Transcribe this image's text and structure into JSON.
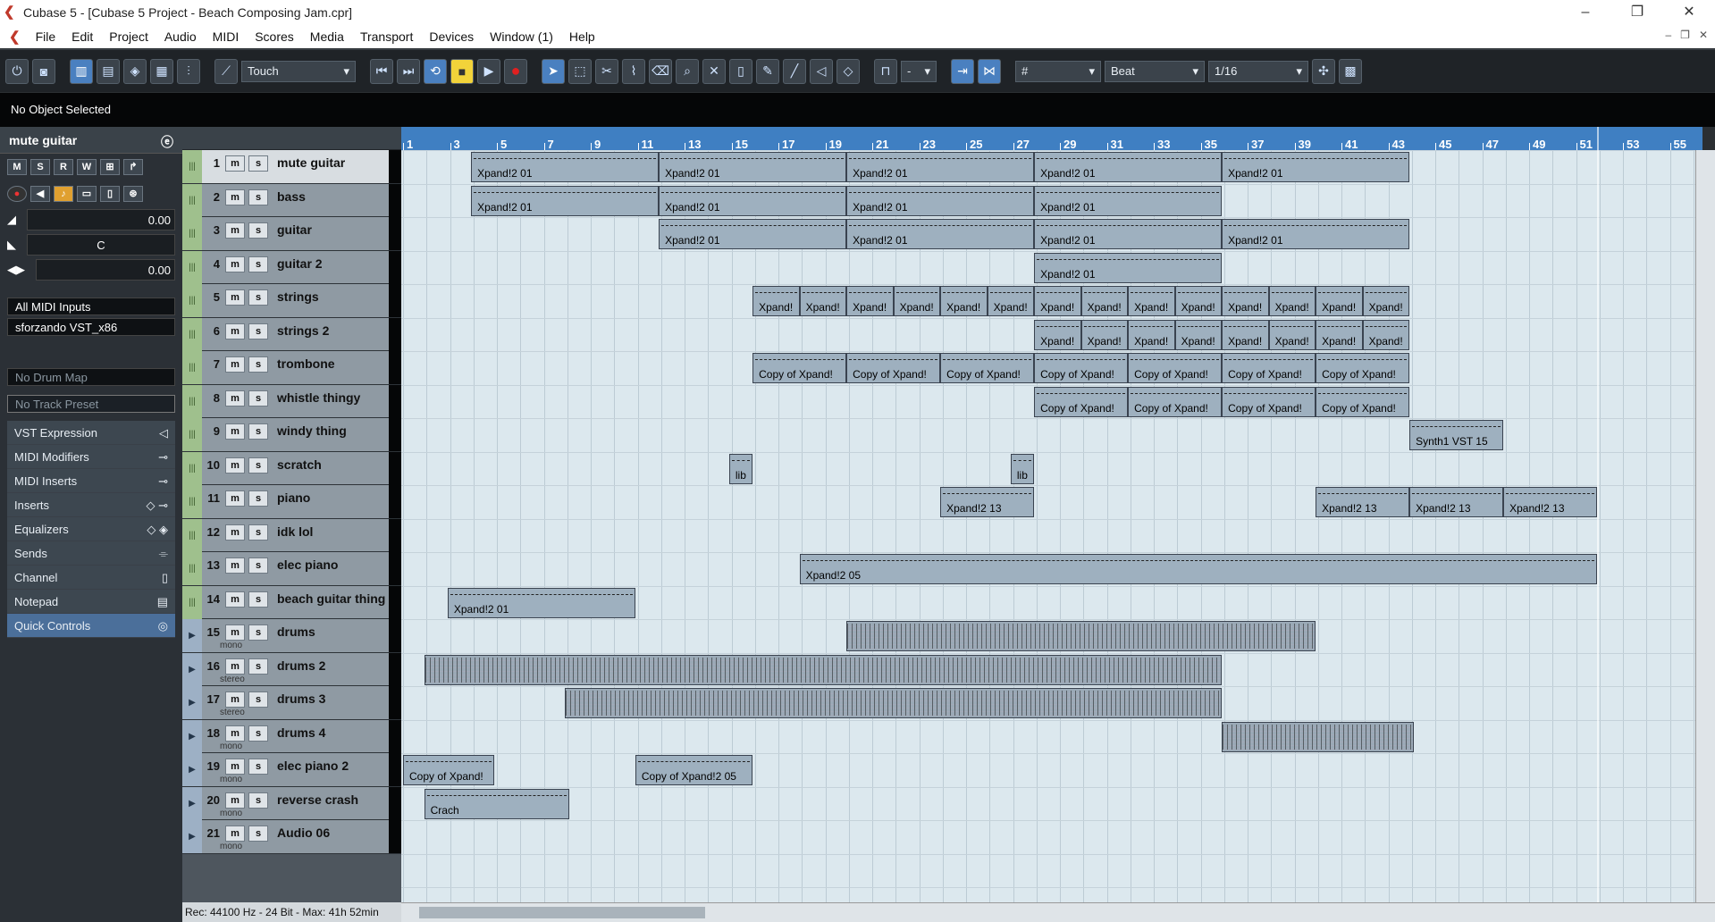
{
  "window": {
    "title": "Cubase 5 - [Cubase 5 Project - Beach Composing Jam.cpr]",
    "controls": [
      "–",
      "❐",
      "✕"
    ]
  },
  "menu": [
    "File",
    "Edit",
    "Project",
    "Audio",
    "MIDI",
    "Scores",
    "Media",
    "Transport",
    "Devices",
    "Window (1)",
    "Help"
  ],
  "toolbar": {
    "automation_mode": "Touch",
    "snap_type": "Beat",
    "quantize": "1/16",
    "nudge": "-"
  },
  "info_line": "No Object Selected",
  "inspector": {
    "track_name": "mute guitar",
    "volume": "0.00",
    "pan": "C",
    "delay": "0.00",
    "input": "All MIDI Inputs",
    "output": "sforzando VST_x86",
    "drum_map": "No Drum Map",
    "track_preset": "No Track Preset",
    "sections": [
      "VST Expression",
      "MIDI Modifiers",
      "MIDI Inserts",
      "Inserts",
      "Equalizers",
      "Sends",
      "Channel",
      "Notepad",
      "Quick Controls"
    ]
  },
  "tracks": [
    {
      "num": "1",
      "name": "mute guitar",
      "type": "midi"
    },
    {
      "num": "2",
      "name": "bass",
      "type": "midi"
    },
    {
      "num": "3",
      "name": "guitar",
      "type": "midi"
    },
    {
      "num": "4",
      "name": "guitar 2",
      "type": "midi"
    },
    {
      "num": "5",
      "name": "strings",
      "type": "midi"
    },
    {
      "num": "6",
      "name": "strings 2",
      "type": "midi"
    },
    {
      "num": "7",
      "name": "trombone",
      "type": "midi"
    },
    {
      "num": "8",
      "name": "whistle thingy",
      "type": "midi"
    },
    {
      "num": "9",
      "name": "windy thing",
      "type": "midi"
    },
    {
      "num": "10",
      "name": "scratch",
      "type": "midi"
    },
    {
      "num": "11",
      "name": "piano",
      "type": "midi"
    },
    {
      "num": "12",
      "name": "idk lol",
      "type": "midi"
    },
    {
      "num": "13",
      "name": "elec piano",
      "type": "midi"
    },
    {
      "num": "14",
      "name": "beach guitar thing",
      "type": "midi"
    },
    {
      "num": "15",
      "name": "drums",
      "type": "audio",
      "sub": "mono"
    },
    {
      "num": "16",
      "name": "drums 2",
      "type": "audio",
      "sub": "stereo"
    },
    {
      "num": "17",
      "name": "drums 3",
      "type": "audio",
      "sub": "stereo"
    },
    {
      "num": "18",
      "name": "drums 4",
      "type": "audio",
      "sub": "mono"
    },
    {
      "num": "19",
      "name": "elec piano 2",
      "type": "audio",
      "sub": "mono"
    },
    {
      "num": "20",
      "name": "reverse crash",
      "type": "audio",
      "sub": "mono"
    },
    {
      "num": "21",
      "name": "Audio 06",
      "type": "audio",
      "sub": "mono"
    }
  ],
  "ruler_bars": [
    "1",
    "3",
    "5",
    "7",
    "9",
    "11",
    "13",
    "15",
    "17",
    "19",
    "21",
    "23",
    "25",
    "27",
    "29",
    "31",
    "33",
    "35",
    "37",
    "39",
    "41",
    "43",
    "45",
    "47",
    "49",
    "51",
    "53",
    "55"
  ],
  "parts": [
    {
      "track": 0,
      "start": 3.9,
      "end": 11.9,
      "label": "Xpand!2 01"
    },
    {
      "track": 0,
      "start": 11.9,
      "end": 19.9,
      "label": "Xpand!2 01"
    },
    {
      "track": 0,
      "start": 19.9,
      "end": 27.9,
      "label": "Xpand!2 01"
    },
    {
      "track": 0,
      "start": 27.9,
      "end": 35.9,
      "label": "Xpand!2 01"
    },
    {
      "track": 0,
      "start": 35.9,
      "end": 43.9,
      "label": "Xpand!2 01"
    },
    {
      "track": 1,
      "start": 3.9,
      "end": 11.9,
      "label": "Xpand!2 01"
    },
    {
      "track": 1,
      "start": 11.9,
      "end": 19.9,
      "label": "Xpand!2 01"
    },
    {
      "track": 1,
      "start": 19.9,
      "end": 27.9,
      "label": "Xpand!2 01"
    },
    {
      "track": 1,
      "start": 27.9,
      "end": 35.9,
      "label": "Xpand!2 01"
    },
    {
      "track": 2,
      "start": 11.9,
      "end": 19.9,
      "label": "Xpand!2 01"
    },
    {
      "track": 2,
      "start": 19.9,
      "end": 27.9,
      "label": "Xpand!2 01"
    },
    {
      "track": 2,
      "start": 27.9,
      "end": 35.9,
      "label": "Xpand!2 01"
    },
    {
      "track": 2,
      "start": 35.9,
      "end": 43.9,
      "label": "Xpand!2 01"
    },
    {
      "track": 3,
      "start": 27.9,
      "end": 35.9,
      "label": "Xpand!2 01"
    },
    {
      "track": 4,
      "start": 15.9,
      "end": 17.9,
      "label": "Xpand!"
    },
    {
      "track": 4,
      "start": 17.9,
      "end": 19.9,
      "label": "Xpand!"
    },
    {
      "track": 4,
      "start": 19.9,
      "end": 21.9,
      "label": "Xpand!"
    },
    {
      "track": 4,
      "start": 21.9,
      "end": 23.9,
      "label": "Xpand!"
    },
    {
      "track": 4,
      "start": 23.9,
      "end": 25.9,
      "label": "Xpand!"
    },
    {
      "track": 4,
      "start": 25.9,
      "end": 27.9,
      "label": "Xpand!"
    },
    {
      "track": 4,
      "start": 27.9,
      "end": 29.9,
      "label": "Xpand!"
    },
    {
      "track": 4,
      "start": 29.9,
      "end": 31.9,
      "label": "Xpand!"
    },
    {
      "track": 4,
      "start": 31.9,
      "end": 33.9,
      "label": "Xpand!"
    },
    {
      "track": 4,
      "start": 33.9,
      "end": 35.9,
      "label": "Xpand!"
    },
    {
      "track": 4,
      "start": 35.9,
      "end": 37.9,
      "label": "Xpand!"
    },
    {
      "track": 4,
      "start": 37.9,
      "end": 39.9,
      "label": "Xpand!"
    },
    {
      "track": 4,
      "start": 39.9,
      "end": 41.9,
      "label": "Xpand!"
    },
    {
      "track": 4,
      "start": 41.9,
      "end": 43.9,
      "label": "Xpand!"
    },
    {
      "track": 5,
      "start": 27.9,
      "end": 29.9,
      "label": "Xpand!"
    },
    {
      "track": 5,
      "start": 29.9,
      "end": 31.9,
      "label": "Xpand!"
    },
    {
      "track": 5,
      "start": 31.9,
      "end": 33.9,
      "label": "Xpand!"
    },
    {
      "track": 5,
      "start": 33.9,
      "end": 35.9,
      "label": "Xpand!"
    },
    {
      "track": 5,
      "start": 35.9,
      "end": 37.9,
      "label": "Xpand!"
    },
    {
      "track": 5,
      "start": 37.9,
      "end": 39.9,
      "label": "Xpand!"
    },
    {
      "track": 5,
      "start": 39.9,
      "end": 41.9,
      "label": "Xpand!"
    },
    {
      "track": 5,
      "start": 41.9,
      "end": 43.9,
      "label": "Xpand!"
    },
    {
      "track": 6,
      "start": 15.9,
      "end": 19.9,
      "label": "Copy of Xpand!"
    },
    {
      "track": 6,
      "start": 19.9,
      "end": 23.9,
      "label": "Copy of Xpand!"
    },
    {
      "track": 6,
      "start": 23.9,
      "end": 27.9,
      "label": "Copy of Xpand!"
    },
    {
      "track": 6,
      "start": 27.9,
      "end": 31.9,
      "label": "Copy of Xpand!"
    },
    {
      "track": 6,
      "start": 31.9,
      "end": 35.9,
      "label": "Copy of Xpand!"
    },
    {
      "track": 6,
      "start": 35.9,
      "end": 39.9,
      "label": "Copy of Xpand!"
    },
    {
      "track": 6,
      "start": 39.9,
      "end": 43.9,
      "label": "Copy of Xpand!"
    },
    {
      "track": 7,
      "start": 27.9,
      "end": 31.9,
      "label": "Copy of Xpand!"
    },
    {
      "track": 7,
      "start": 31.9,
      "end": 35.9,
      "label": "Copy of Xpand!"
    },
    {
      "track": 7,
      "start": 35.9,
      "end": 39.9,
      "label": "Copy of Xpand!"
    },
    {
      "track": 7,
      "start": 39.9,
      "end": 43.9,
      "label": "Copy of Xpand!"
    },
    {
      "track": 8,
      "start": 43.9,
      "end": 47.9,
      "label": "Synth1 VST 15"
    },
    {
      "track": 9,
      "start": 14.9,
      "end": 15.9,
      "label": "lib"
    },
    {
      "track": 9,
      "start": 26.9,
      "end": 27.9,
      "label": "lib"
    },
    {
      "track": 10,
      "start": 23.9,
      "end": 27.9,
      "label": "Xpand!2 13"
    },
    {
      "track": 10,
      "start": 39.9,
      "end": 43.9,
      "label": "Xpand!2 13"
    },
    {
      "track": 10,
      "start": 43.9,
      "end": 47.9,
      "label": "Xpand!2 13"
    },
    {
      "track": 10,
      "start": 47.9,
      "end": 51.9,
      "label": "Xpand!2 13"
    },
    {
      "track": 12,
      "start": 17.9,
      "end": 51.9,
      "label": "Xpand!2 05"
    },
    {
      "track": 13,
      "start": 2.9,
      "end": 10.9,
      "label": "Xpand!2 01"
    },
    {
      "track": 14,
      "start": 19.9,
      "end": 39.9,
      "label": "",
      "drum": true
    },
    {
      "track": 15,
      "start": 1.9,
      "end": 35.9,
      "label": "",
      "drum": true
    },
    {
      "track": 16,
      "start": 7.9,
      "end": 35.9,
      "label": "",
      "drum": true
    },
    {
      "track": 17,
      "start": 35.9,
      "end": 44.1,
      "label": "",
      "drum": true
    },
    {
      "track": 18,
      "start": 1.0,
      "end": 4.9,
      "label": "Copy of Xpand!"
    },
    {
      "track": 18,
      "start": 10.9,
      "end": 15.9,
      "label": "Copy of Xpand!2 05"
    },
    {
      "track": 19,
      "start": 1.9,
      "end": 8.1,
      "label": "Crach"
    }
  ],
  "status": "Rec: 44100 Hz - 24 Bit - Max: 41h 52min"
}
